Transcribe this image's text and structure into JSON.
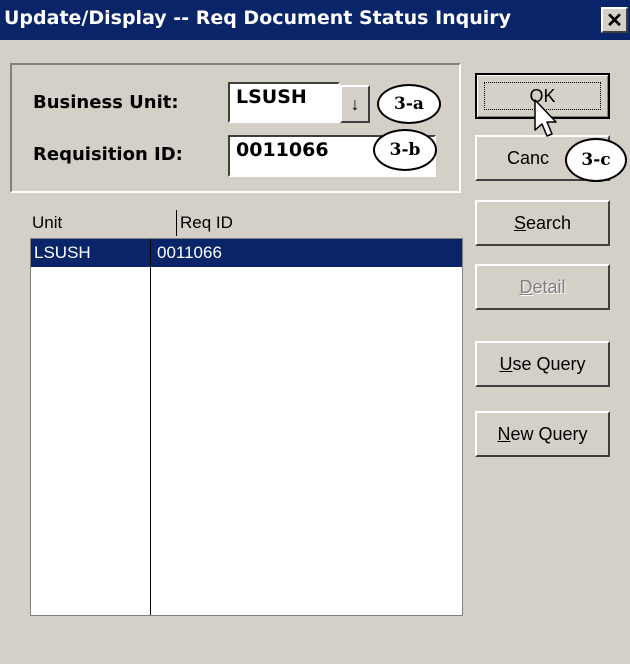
{
  "window": {
    "title": "Update/Display -- Req Document Status Inquiry",
    "close_label": "✕"
  },
  "criteria": {
    "business_unit_label": "Business Unit:",
    "business_unit_value": "LSUSH",
    "requisition_id_label": "Requisition ID:",
    "requisition_id_value": "0011066",
    "dropdown_glyph": "↓"
  },
  "callouts": {
    "a": "3-a",
    "b": "3-b",
    "c": "3-c"
  },
  "list": {
    "columns": [
      "Unit",
      "Req ID"
    ],
    "rows": [
      {
        "unit": "LSUSH",
        "req_id": "0011066",
        "selected": true
      }
    ]
  },
  "buttons": {
    "ok": "OK",
    "cancel": "Canc",
    "search_first": "S",
    "search_rest": "earch",
    "detail_first": "D",
    "detail_rest": "etail",
    "use_query_first": "U",
    "use_query_rest": "se Query",
    "new_query_first": "N",
    "new_query_rest": "ew Query"
  }
}
